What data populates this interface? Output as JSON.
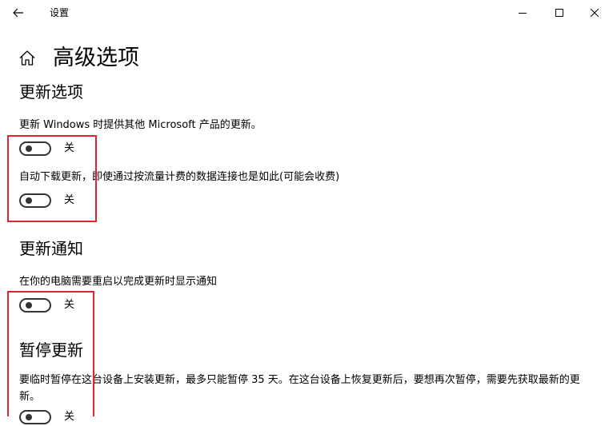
{
  "window": {
    "title": "设置",
    "back_icon": "back-arrow-icon",
    "minimize_icon": "minimize-icon",
    "maximize_icon": "maximize-icon",
    "close_icon": "close-icon"
  },
  "page": {
    "home_icon": "home-icon",
    "title": "高级选项"
  },
  "update_options": {
    "title": "更新选项",
    "other_products": {
      "label": "更新 Windows 时提供其他 Microsoft 产品的更新。",
      "state_text": "关",
      "on": false
    },
    "metered_download": {
      "label": "自动下载更新，即使通过按流量计费的数据连接也是如此(可能会收费)",
      "state_text": "关",
      "on": false
    }
  },
  "update_notifications": {
    "title": "更新通知",
    "restart_notify": {
      "label": "在你的电脑需要重启以完成更新时显示通知",
      "state_text": "关",
      "on": false
    }
  },
  "pause_updates": {
    "title": "暂停更新",
    "description": "要临时暂停在这台设备上安装更新，最多只能暂停 35 天。在这台设备上恢复更新后，要想再次暂停，需要先获取最新的更新。",
    "toggle": {
      "state_text": "关",
      "on": false
    }
  },
  "colors": {
    "highlight": "#e0232e",
    "toggle_off": "#333333"
  }
}
